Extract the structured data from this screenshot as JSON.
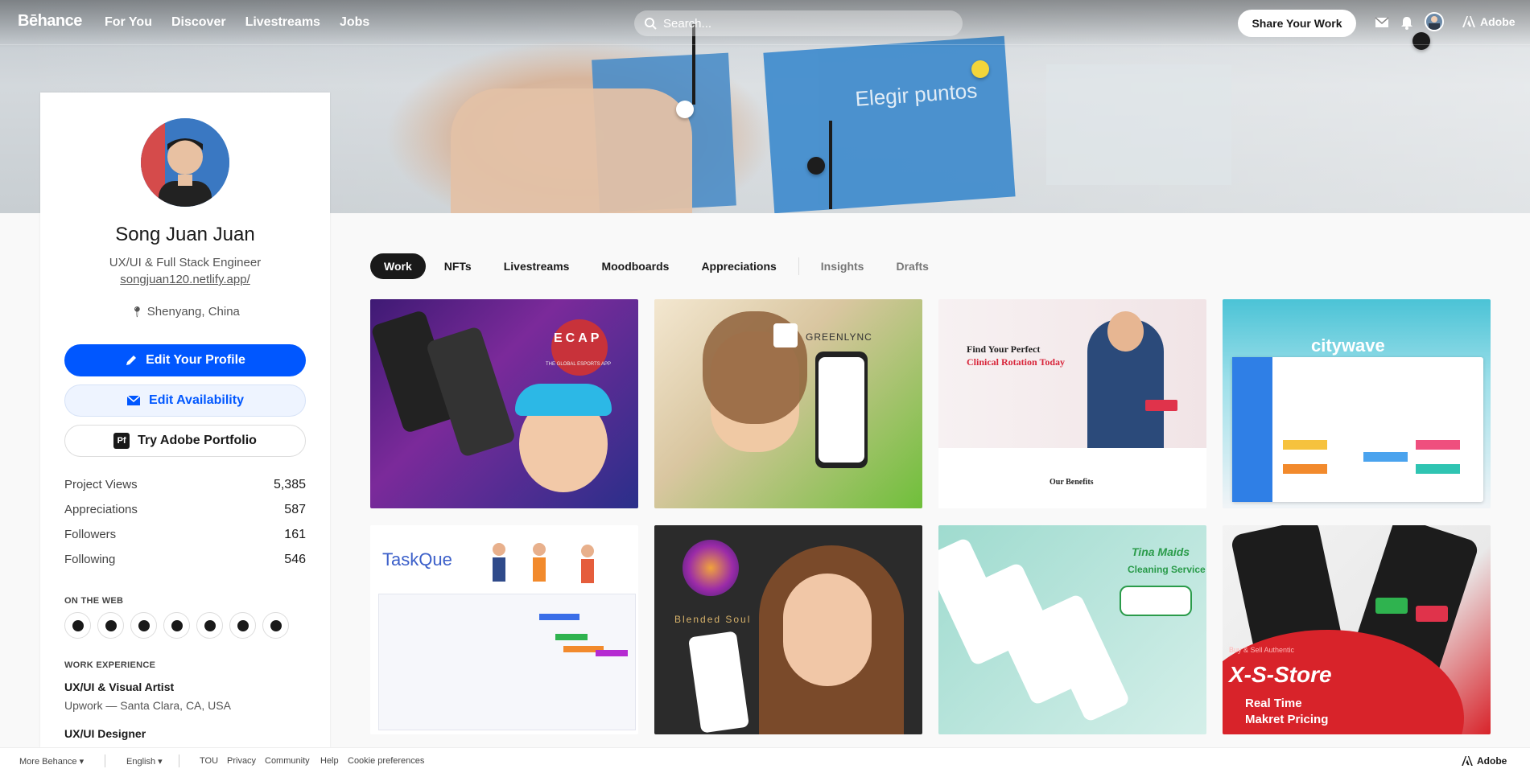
{
  "header": {
    "logo": "Bēhance",
    "nav": [
      "For You",
      "Discover",
      "Livestreams",
      "Jobs"
    ],
    "search_placeholder": "Search...",
    "share_button": "Share Your Work",
    "adobe_label": "Adobe"
  },
  "hero": {
    "card_text": "Elegir puntos"
  },
  "profile": {
    "name": "Song Juan Juan",
    "title": "UX/UI & Full Stack Engineer",
    "website": "songjuan120.netlify.app/",
    "location": "Shenyang, China",
    "edit_profile": "Edit Your Profile",
    "edit_availability": "Edit Availability",
    "try_portfolio": "Try Adobe Portfolio",
    "portfolio_badge": "Pf",
    "stats": [
      {
        "label": "Project Views",
        "value": "5,385"
      },
      {
        "label": "Appreciations",
        "value": "587"
      },
      {
        "label": "Followers",
        "value": "161"
      },
      {
        "label": "Following",
        "value": "546"
      }
    ],
    "on_the_web_heading": "ON THE WEB",
    "social": [
      "facebook-icon",
      "linkedin-icon",
      "dribbble-icon",
      "pinterest-icon",
      "youtube-icon",
      "github-icon",
      "twitter-icon"
    ],
    "work_experience_heading": "WORK EXPERIENCE",
    "jobs": [
      {
        "title": "UX/UI & Visual Artist",
        "subtitle": "Upwork — Santa Clara, CA, USA"
      },
      {
        "title": "UX/UI Designer",
        "subtitle": ""
      }
    ]
  },
  "tabs": [
    {
      "label": "Work",
      "active": true
    },
    {
      "label": "NFTs",
      "active": false
    },
    {
      "label": "Livestreams",
      "active": false
    },
    {
      "label": "Moodboards",
      "active": false
    },
    {
      "label": "Appreciations",
      "active": false
    },
    {
      "label": "Insights",
      "active": false,
      "muted": true
    },
    {
      "label": "Drafts",
      "active": false,
      "muted": true
    }
  ],
  "projects": [
    {
      "text": "ECAP",
      "sub": "THE GLOBAL ESPORTS APP"
    },
    {
      "text": "GREENLYNC",
      "sub": ""
    },
    {
      "text": "Find Your Perfect",
      "sub": "Clinical Rotation Today",
      "extra": "Our Benefits"
    },
    {
      "text": "citywave",
      "sub": ""
    },
    {
      "text": "TaskQue",
      "sub": ""
    },
    {
      "text": "Blended Soul",
      "sub": ""
    },
    {
      "text": "Tina Maids",
      "sub": "Cleaning Service"
    },
    {
      "text": "X-S-Store",
      "sub": "Real Time",
      "extra": "Makret Pricing",
      "tag": "Buy & Sell Authentic"
    }
  ],
  "footer": {
    "more": "More Behance",
    "language": "English",
    "links": [
      "TOU",
      "Privacy",
      "Community",
      "Help",
      "Cookie preferences"
    ],
    "adobe": "Adobe"
  },
  "colors": {
    "accent": "#0057ff",
    "active_tab": "#191919"
  }
}
